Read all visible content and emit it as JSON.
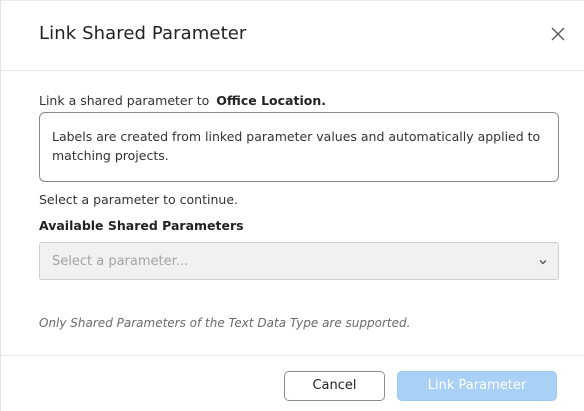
{
  "dialog": {
    "title": "Link Shared Parameter",
    "close_icon": "close-icon",
    "intro_text": "Link a shared parameter to",
    "intro_target": "Office Location.",
    "info_text": "Labels are created from linked parameter values and automatically applied to matching projects.",
    "prompt_text": "Select a parameter to continue.",
    "field_label": "Available Shared Parameters",
    "select": {
      "placeholder": "Select a parameter...",
      "chevron_icon": "chevron-down-icon"
    },
    "note_text": "Only Shared Parameters of the Text Data Type are supported.",
    "buttons": {
      "cancel_label": "Cancel",
      "link_label": "Link Parameter"
    },
    "colors": {
      "primary_disabled": "#a9d0f5",
      "select_bg": "#f1f1f1",
      "border": "#8a8a8a"
    }
  }
}
